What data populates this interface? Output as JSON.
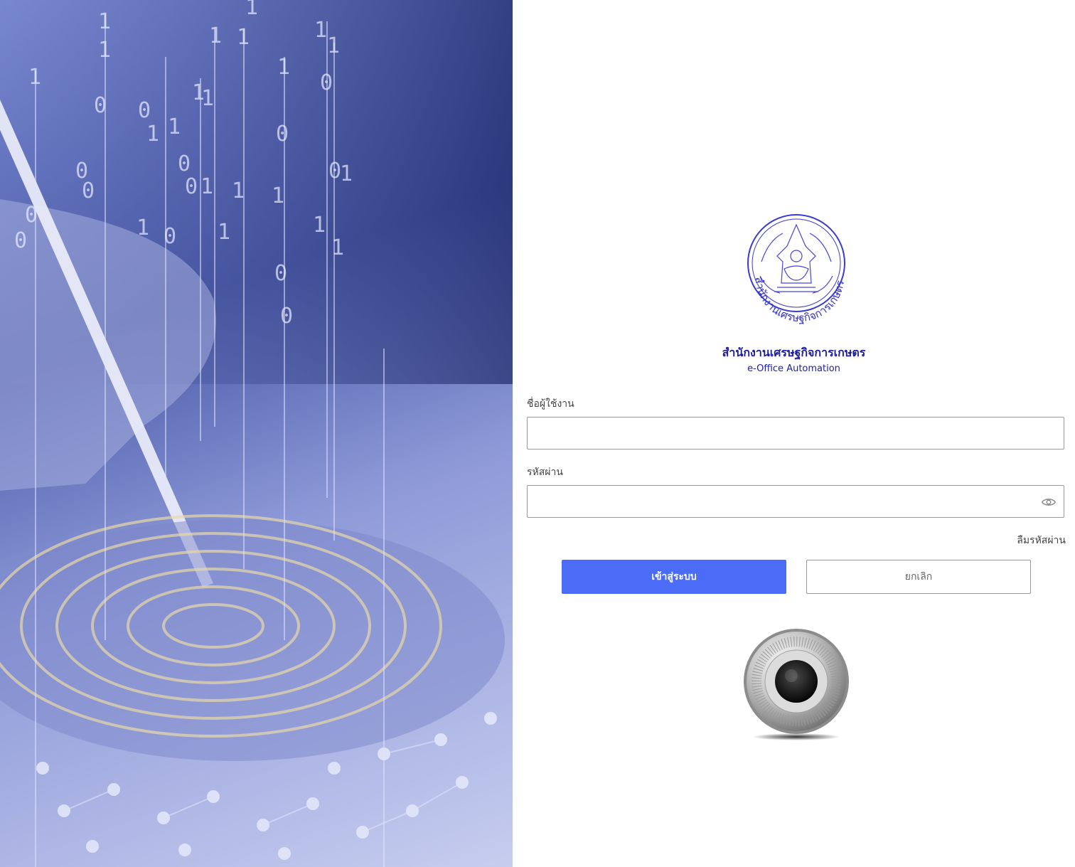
{
  "hero": {
    "image_name": "digital-fingerprint-background"
  },
  "organization": {
    "seal_text": "สำนักงานเศรษฐกิจการเกษตร",
    "name": "สำนักงานเศรษฐกิจการเกษตร",
    "subtitle": "e-Office Automation"
  },
  "form": {
    "username_label": "ชื่อผู้ใช้งาน",
    "username_value": "",
    "password_label": "รหัสผ่าน",
    "password_value": "",
    "password_toggle_icon": "eye-icon",
    "forgot_password": "ลืมรหัสผ่าน",
    "login_button": "เข้าสู่ระบบ",
    "cancel_button": "ยกเลิก"
  },
  "decor": {
    "dial_icon": "safe-dial-icon"
  },
  "colors": {
    "accent": "#4a6cf7",
    "brand_text": "#1e1e9a"
  }
}
